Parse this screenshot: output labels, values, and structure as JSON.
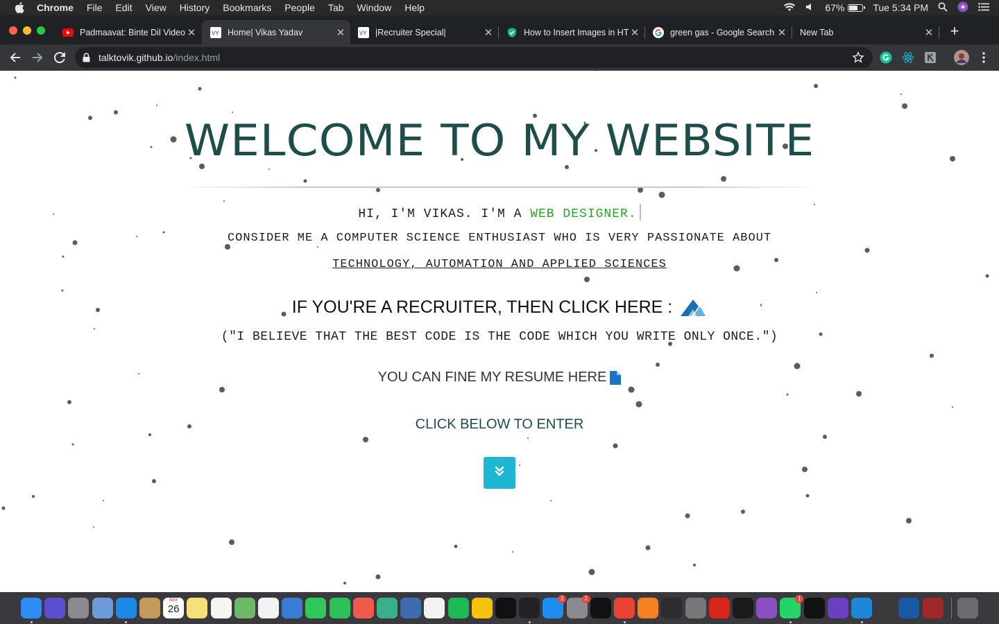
{
  "menubar": {
    "app_name": "Chrome",
    "menus": [
      "File",
      "Edit",
      "View",
      "History",
      "Bookmarks",
      "People",
      "Tab",
      "Window",
      "Help"
    ],
    "battery_percent": "67%",
    "battery_level": 0.67,
    "clock": "Tue 5:34 PM"
  },
  "tabs": [
    {
      "title": "Padmaavat: Binte Dil Video",
      "favicon": "youtube-icon",
      "active": false
    },
    {
      "title": "Home| Vikas Yadav",
      "favicon": "vy-logo-icon",
      "active": true
    },
    {
      "title": "|Recruiter Special|",
      "favicon": "vy-logo-icon",
      "active": false
    },
    {
      "title": "How to Insert Images in HTML",
      "favicon": "shield-icon",
      "active": false
    },
    {
      "title": "green gas - Google Search",
      "favicon": "google-icon",
      "active": false
    },
    {
      "title": "New Tab",
      "favicon": "",
      "active": false
    }
  ],
  "address_bar": {
    "host": "talktovik.github.io",
    "path": "/index.html"
  },
  "page": {
    "title": "WELCOME TO MY WEBSITE",
    "intro_prefix": "HI, I'M VIKAS. I'M A ",
    "intro_role": "WEB DESIGNER.",
    "about_line1": "CONSIDER ME A COMPUTER SCIENCE ENTHUSIAST WHO IS VERY PASSIONATE ABOUT",
    "about_line2": "TECHNOLOGY, AUTOMATION AND APPLIED SCIENCES",
    "recruiter_text": "IF YOU'RE A RECRUITER, THEN CLICK HERE :",
    "quote": "(\"I BELIEVE THAT THE BEST CODE IS THE CODE WHICH YOU WRITE ONLY ONCE.\")",
    "resume_text": "YOU CAN FINE MY RESUME HERE",
    "enter_label": "CLICK BELOW TO ENTER",
    "accent_color": "#1f4d4a",
    "role_color": "#2aa52a",
    "button_color": "#1fb6d3"
  },
  "dock": {
    "calendar_month": "MAY",
    "calendar_day": "26",
    "badges": [
      "2",
      "2",
      "1"
    ]
  }
}
